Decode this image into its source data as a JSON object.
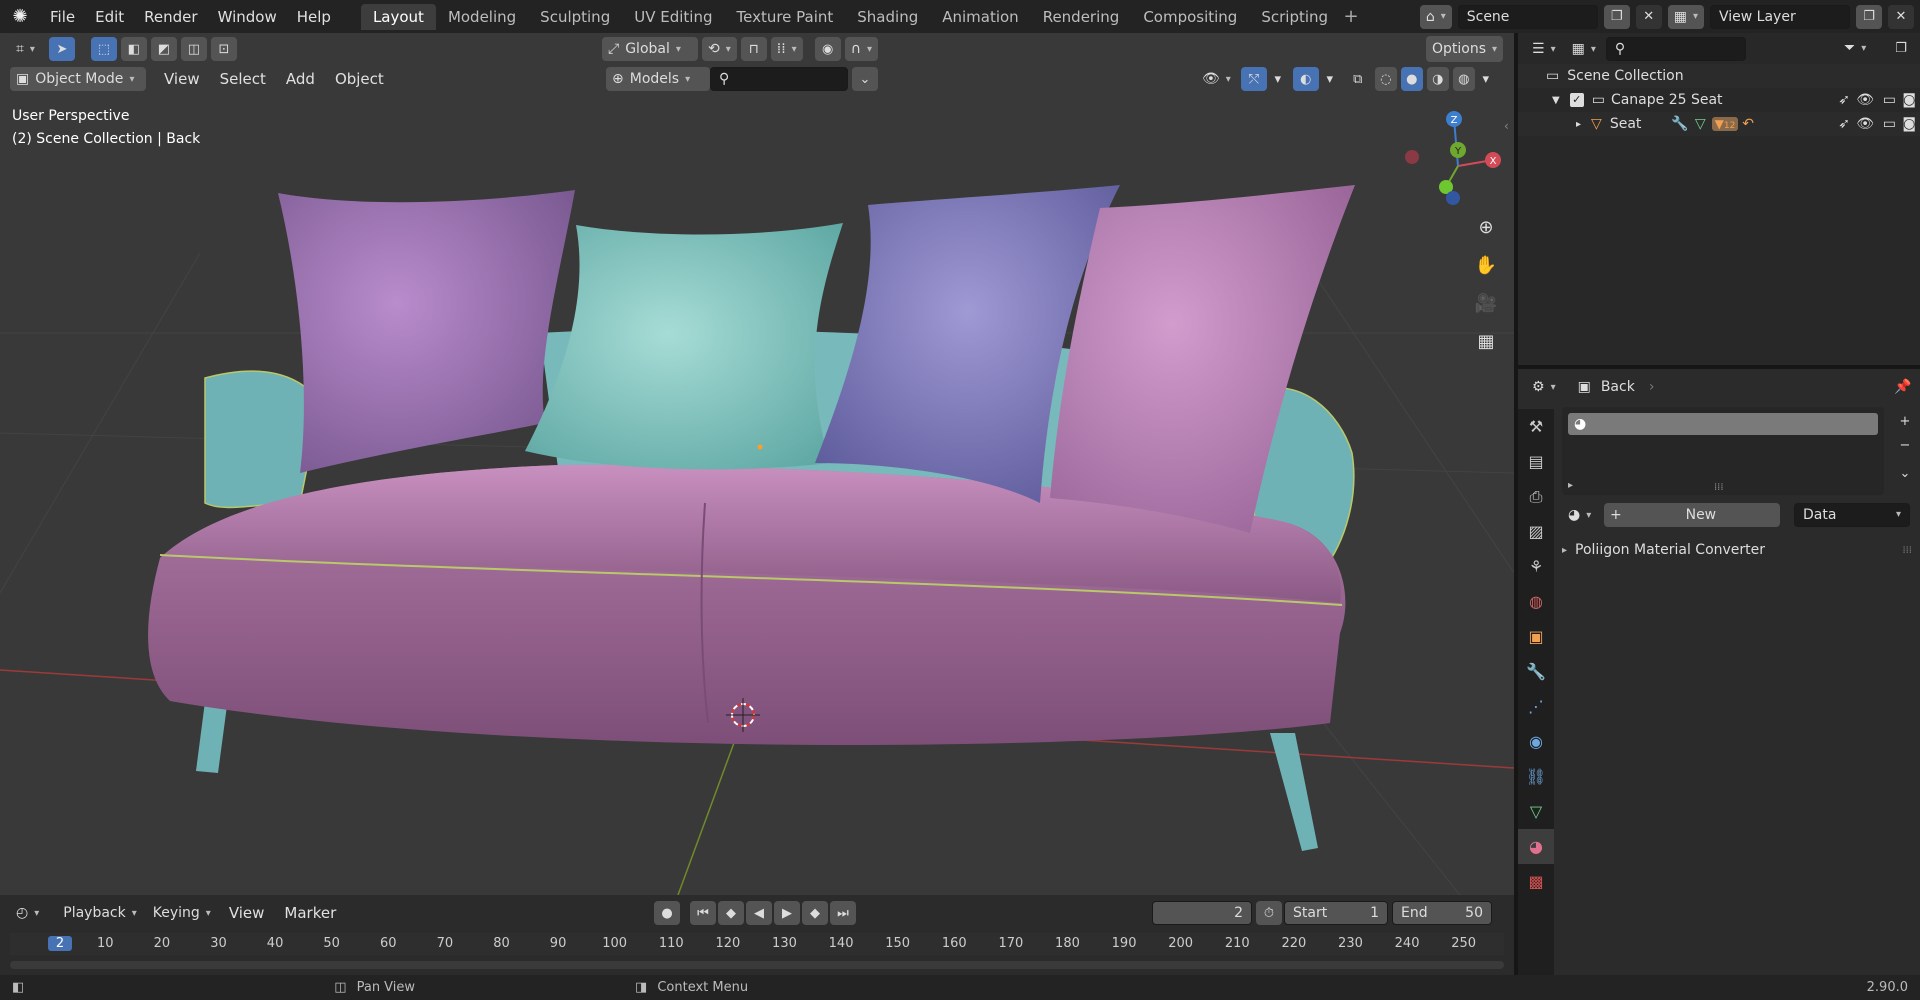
{
  "topbar": {
    "menus": [
      "File",
      "Edit",
      "Render",
      "Window",
      "Help"
    ],
    "workspaces": [
      "Layout",
      "Modeling",
      "Sculpting",
      "UV Editing",
      "Texture Paint",
      "Shading",
      "Animation",
      "Rendering",
      "Compositing",
      "Scripting"
    ],
    "active_workspace": "Layout",
    "scene_name": "Scene",
    "view_layer": "View Layer"
  },
  "viewport": {
    "mode": "Object Mode",
    "menus": [
      "View",
      "Select",
      "Add",
      "Object"
    ],
    "transform_orientation": "Global",
    "collection_dropdown": "Models",
    "options_label": "Options",
    "overlay_title": "User Perspective",
    "overlay_subtitle": "(2) Scene Collection | Back",
    "gizmo_axes": {
      "x": "X",
      "y": "Y",
      "z": "Z"
    }
  },
  "timeline": {
    "menus": [
      "Playback",
      "Keying",
      "View",
      "Marker"
    ],
    "current_frame": "2",
    "start_label": "Start",
    "start_value": "1",
    "end_label": "End",
    "end_value": "50",
    "frame_marks": [
      "2",
      "10",
      "20",
      "30",
      "40",
      "50",
      "60",
      "70",
      "80",
      "90",
      "100",
      "110",
      "120",
      "130",
      "140",
      "150",
      "160",
      "170",
      "180",
      "190",
      "200",
      "210",
      "220",
      "230",
      "240",
      "250"
    ]
  },
  "statusbar": {
    "pan_view": "Pan View",
    "context_menu": "Context Menu",
    "version": "2.90.0"
  },
  "outliner": {
    "root": "Scene Collection",
    "collection": "Canape 25 Seat",
    "object": "Seat",
    "mesh_badge": "12"
  },
  "properties": {
    "object_name": "Back",
    "new_button": "New",
    "data_dropdown": "Data",
    "panel": "Poliigon Material Converter"
  },
  "colors": {
    "accent": "#4772b3",
    "pillow_purple": "#9d73b0",
    "pillow_teal": "#79c2bc",
    "pillow_blue": "#7f77bb",
    "pillow_pink": "#b77eb4",
    "sofa_pink": "#b37aa8",
    "frame_teal": "#6fb2b6"
  }
}
